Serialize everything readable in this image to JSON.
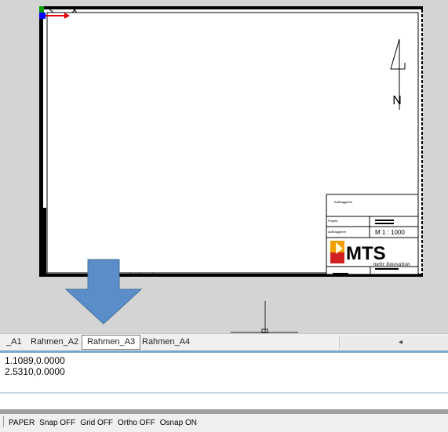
{
  "layout_tabs": [
    {
      "label": "_A1",
      "active": false
    },
    {
      "label": "Rahmen_A2",
      "active": false
    },
    {
      "label": "Rahmen_A3",
      "active": true
    },
    {
      "label": "Rahmen_A4",
      "active": false
    }
  ],
  "scroll_arrow": "◂",
  "drawing": {
    "north_label": "N",
    "title_block": {
      "client_field": "Auftraggeber",
      "project_field": "Projekt",
      "contractor_field": "Auftraggeber",
      "scale": "M 1 : 1000",
      "logo_text": "MTS",
      "logo_slogan": "mehr Innovation"
    }
  },
  "command_history": [
    "1.1089,0.0000",
    "2.5310,0.0000"
  ],
  "status_bar": {
    "space": "PAPER",
    "snap": "Snap OFF",
    "grid": "Grid OFF",
    "ortho": "Ortho OFF",
    "osnap": "Osnap ON"
  },
  "colors": {
    "canvas_bg": "#d4d4d4",
    "arrow_blue": "#5b8ec9",
    "ucs_red": "#e00000",
    "ucs_blue": "#0000ff",
    "logo_orange": "#f0a000",
    "logo_red": "#d02020"
  },
  "icons": {
    "down_arrow": "big-down-arrow-icon",
    "crosshair": "cursor-crosshair-icon",
    "ucs": "ucs-axis-icon",
    "north": "north-arrow-icon"
  }
}
